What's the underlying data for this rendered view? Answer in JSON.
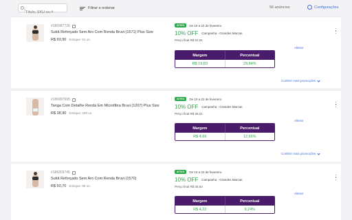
{
  "toolbar": {
    "search_placeholder": "Título, SKU ou #",
    "filter_label": "Filtrar e ordenar",
    "count_label": "56 anúncios",
    "settings_label": "Configurações"
  },
  "table_headers": {
    "margin": "Margem",
    "percent": "Percentual"
  },
  "labels": {
    "alter": "Alterar",
    "more_promotions": "Conferir mais promoções"
  },
  "products": [
    {
      "sku": "#186987726",
      "name": "Sutiã Reforçado Sem Aro Com Renda Bruvi (1571) Plus Size",
      "price": "R$ 69,90",
      "stock": "Estoque: 91 un.",
      "status": "ATIVO",
      "period": "De 10 a 22 de fevereiro",
      "discount": "10% OFF",
      "campaign": "Campanha - Grandes Marcas",
      "final_price": "Preço final R$ 62,91",
      "margin": "R$ 19,83",
      "percent": "29,84%"
    },
    {
      "sku": "#186997695",
      "name": "Tanga Com Detalhe Renda Em Microfibra Bruvi (1207) Plus Size",
      "price": "R$ 38,90",
      "stock": "Estoque: 299 un.",
      "status": "ATIVO",
      "period": "De 10 a 22 de fevereiro",
      "discount": "10% OFF",
      "campaign": "Campanha - Grandes Marcas",
      "final_price": "Preço final R$ 35,01",
      "margin": "R$ 4,66",
      "percent": "12,66%"
    },
    {
      "sku": "#186203745",
      "name": "Sutiã Reforçado Sem Aro Com Renda Bruvi (1570)",
      "price": "R$ 50,70",
      "stock": "Estoque: 89 un.",
      "status": "ATIVO",
      "period": "De 10 a 22 de fevereiro",
      "discount": "10% OFF",
      "campaign": "Campanha - Grandes Marcas",
      "final_price": "Preço final R$ 45,63",
      "margin": "R$ 4,22",
      "percent": "9,24%"
    }
  ],
  "colors": {
    "accent": "#3d6fd8",
    "active": "#2aa84a",
    "table_header": "#4a1a6b"
  }
}
